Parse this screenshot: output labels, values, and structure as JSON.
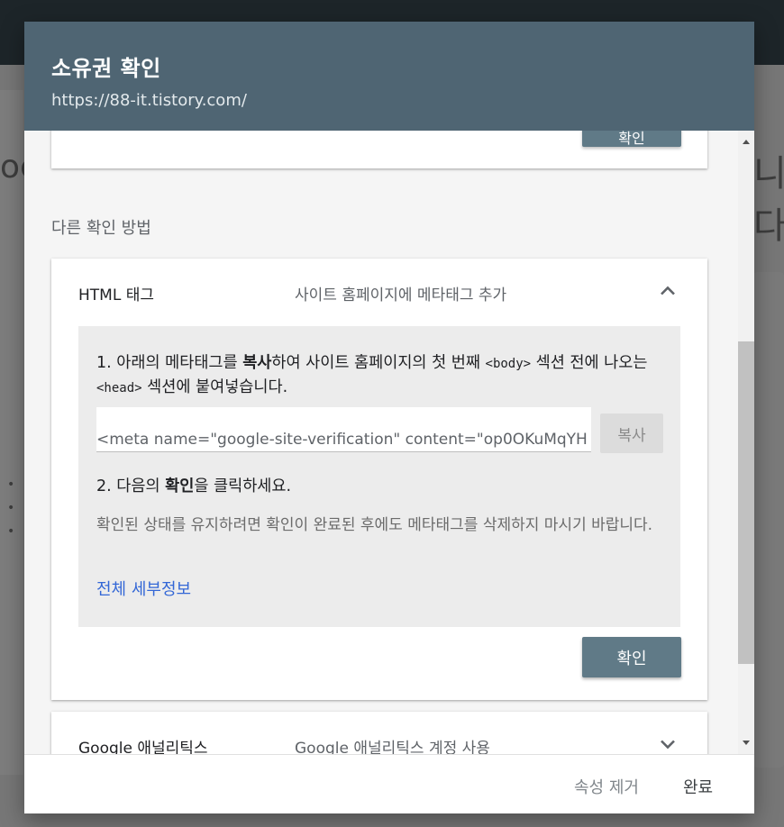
{
  "background": {
    "left_text": "oc",
    "right_text": "니다",
    "bullets": [
      "•",
      "•",
      "•"
    ]
  },
  "dialog": {
    "title": "소유권 확인",
    "subtitle": "https://88-it.tistory.com/",
    "previous_card_button": "확인",
    "other_methods_label": "다른 확인 방법",
    "html_tag_method": {
      "title": "HTML 태그",
      "description": "사이트 홈페이지에 메타태그 추가",
      "expanded": true,
      "step1": {
        "part1": "1. 아래의 메타태그를 ",
        "bold": "복사",
        "part2": "하여 사이트 홈페이지의 첫 번째 ",
        "code1": "<body>",
        "part3": " 섹션 전에 나오는 ",
        "code2": "<head>",
        "part4": " 섹션에 붙여넣습니다."
      },
      "meta_tag_value": "<meta name=\"google-site-verification\" content=\"op0OKuMqYH",
      "copy_button": "복사",
      "step2": {
        "part1": "2. 다음의 ",
        "bold": "확인",
        "part2": "을 클릭하세요."
      },
      "note": "확인된 상태를 유지하려면 확인이 완료된 후에도 메타태그를 삭제하지 마시기 바랍니다.",
      "details_link": "전체 세부정보",
      "confirm_button": "확인"
    },
    "google_analytics_method": {
      "title": "Google 애널리틱스",
      "description": "Google 애널리틱스 계정 사용",
      "expanded": false
    },
    "footer": {
      "remove_property": "속성 제거",
      "done": "완료"
    }
  },
  "colors": {
    "header_bg": "#4f6573",
    "button_bg": "#607a87",
    "link": "#3367d6",
    "inner_box_bg": "#ececec"
  },
  "icons": {
    "collapse": "chevron-up-icon",
    "expand": "chevron-down-icon",
    "scroll_up": "scroll-up-arrow-icon",
    "scroll_down": "scroll-down-arrow-icon"
  }
}
